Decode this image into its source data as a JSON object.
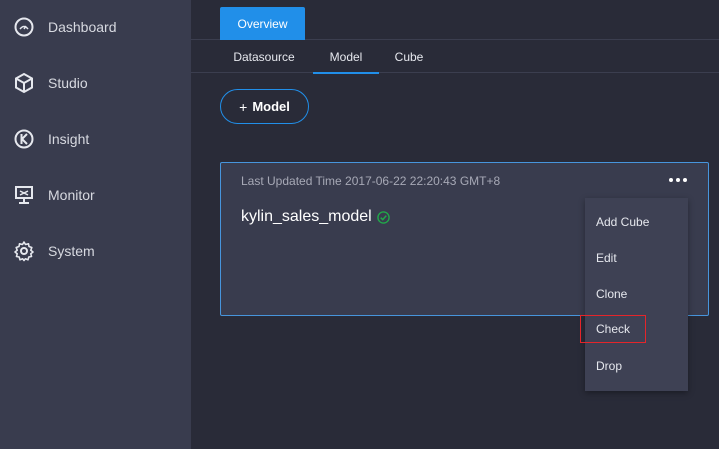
{
  "sidebar": {
    "items": [
      {
        "label": "Dashboard",
        "icon": "dashboard-gauge-icon"
      },
      {
        "label": "Studio",
        "icon": "cube-icon"
      },
      {
        "label": "Insight",
        "icon": "insight-k-icon"
      },
      {
        "label": "Monitor",
        "icon": "monitor-icon"
      },
      {
        "label": "System",
        "icon": "gear-icon"
      }
    ]
  },
  "tabs": {
    "overview": "Overview"
  },
  "subtabs": {
    "items": [
      "Datasource",
      "Model",
      "Cube"
    ],
    "active": "Model"
  },
  "toolbar": {
    "add_model_plus": "+",
    "add_model_label": "Model"
  },
  "model_card": {
    "last_updated": "Last Updated Time 2017-06-22 22:20:43 GMT+8",
    "name": "kylin_sales_model",
    "status_icon": "check-circle-icon"
  },
  "context_menu": {
    "items": [
      "Add Cube",
      "Edit",
      "Clone",
      "Check",
      "Drop"
    ],
    "highlighted": "Check"
  },
  "colors": {
    "accent": "#218fe9",
    "sidebar_bg": "#393c4e",
    "main_bg": "#292b38",
    "status_ok": "#21a84a",
    "highlight_border": "#e5252a"
  }
}
